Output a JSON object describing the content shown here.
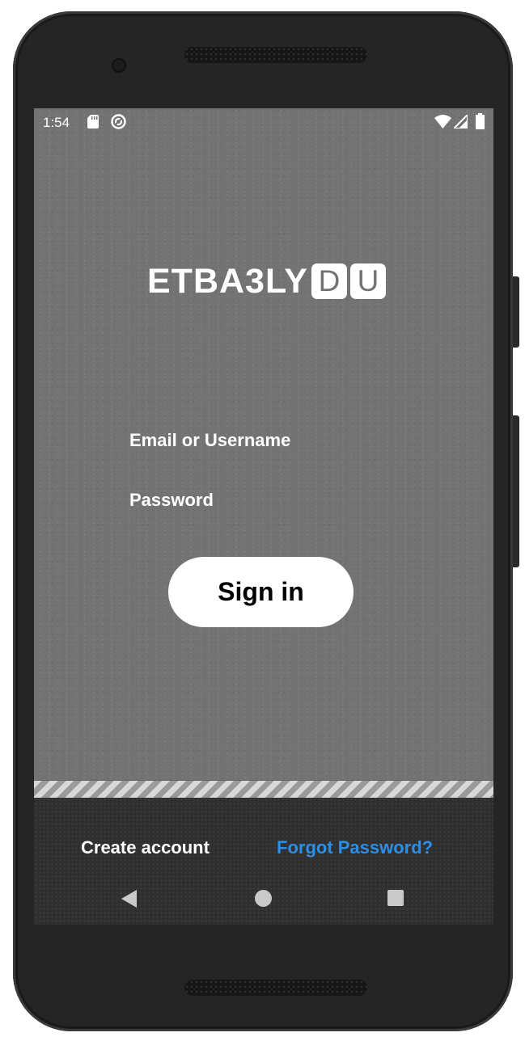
{
  "status_bar": {
    "time": "1:54",
    "left_icons": [
      "sd-card-icon",
      "sync-icon"
    ],
    "right_icons": [
      "wifi-icon",
      "signal-icon",
      "battery-icon"
    ]
  },
  "logo": {
    "text": "ETBA3LY",
    "box_letters": [
      "D",
      "U"
    ]
  },
  "form": {
    "email_label": "Email or Username",
    "password_label": "Password",
    "signin_label": "Sign in"
  },
  "footer": {
    "create_account": "Create account",
    "forgot_password": "Forgot Password?"
  },
  "nav_bar": {
    "icons": [
      "back-icon",
      "home-icon",
      "recents-icon"
    ]
  },
  "colors": {
    "screen_background": "#737373",
    "bottom_panel": "#2f2f2f",
    "link_blue": "#2b8fe8",
    "button_background": "#ffffff"
  }
}
